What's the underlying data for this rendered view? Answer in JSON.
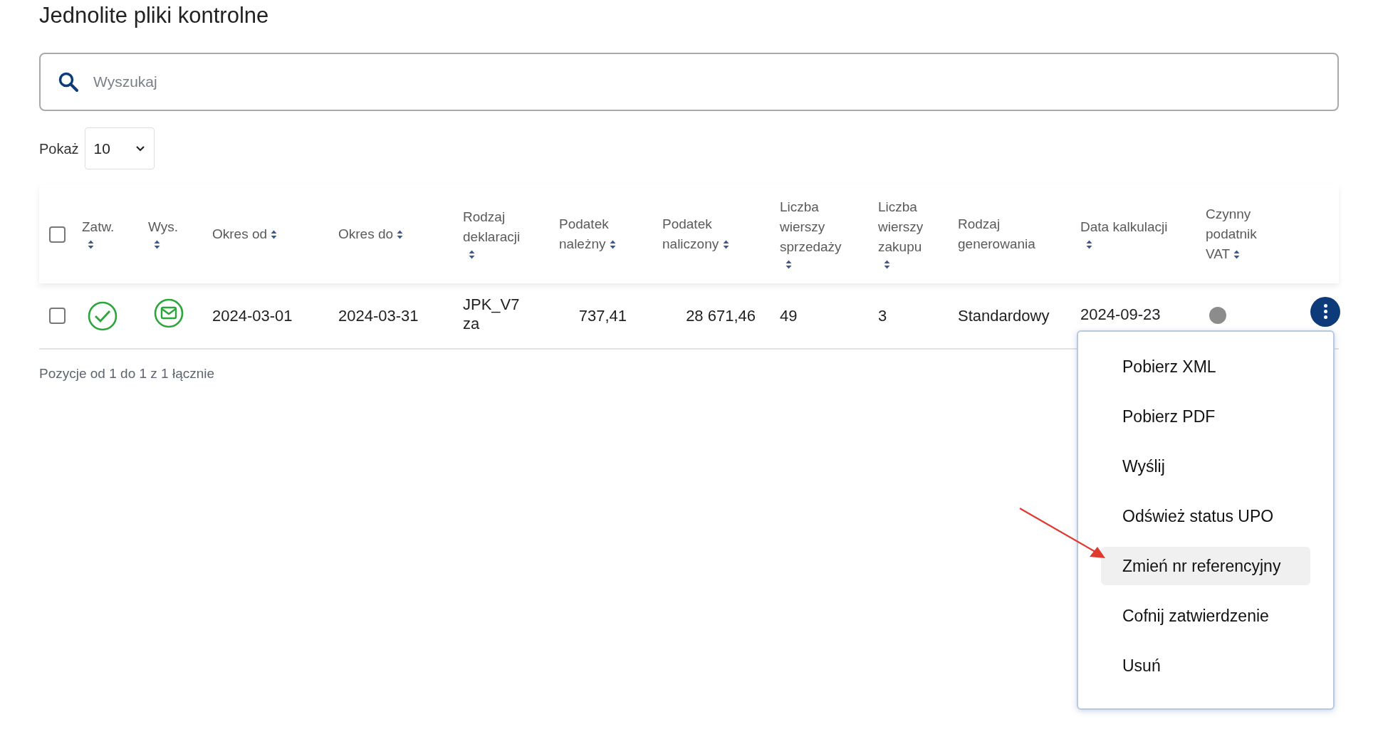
{
  "title": "Jednolite pliki kontrolne",
  "search": {
    "placeholder": "Wyszukaj"
  },
  "page_size": {
    "label": "Pokaż",
    "value": "10"
  },
  "table": {
    "select_all": {
      "checked": false
    },
    "columns": [
      {
        "label": "Zatw.",
        "sortable": true,
        "sort_below": true
      },
      {
        "label": "Wys.",
        "sortable": true,
        "sort_below": true
      },
      {
        "label": "Okres od",
        "sortable": true,
        "sort_below": false
      },
      {
        "label": "Okres do",
        "sortable": true,
        "sort_below": false
      },
      {
        "label": "Rodzaj\ndeklaracji",
        "sortable": true,
        "sort_below": true
      },
      {
        "label": "Podatek\nnależny",
        "sortable": true,
        "sort_below": false
      },
      {
        "label": "Podatek\nnaliczony",
        "sortable": true,
        "sort_below": false
      },
      {
        "label": "Liczba\nwierszy\nsprzedaży",
        "sortable": true,
        "sort_below": true
      },
      {
        "label": "Liczba\nwierszy\nzakupu",
        "sortable": true,
        "sort_below": true
      },
      {
        "label": "Rodzaj\ngenerowania",
        "sortable": false
      },
      {
        "label": "Data kalkulacji",
        "sortable": true,
        "sort_below": true
      },
      {
        "label": "Czynny\npodatnik\nVAT",
        "sortable": true,
        "sort_below": false
      }
    ],
    "rows": [
      {
        "checked": false,
        "approved": true,
        "sent": true,
        "period_from": "2024-03-01",
        "period_to": "2024-03-31",
        "declaration": "JPK_V7\nza",
        "tax_due": "737,41",
        "tax_input": "28 671,46",
        "sales_rows": "49",
        "purchase_rows": "3",
        "generation": "Standardowy",
        "calc_date": "2024-09-23",
        "vat_status": {
          "color": "#8c8c8c"
        }
      }
    ]
  },
  "footer": "Pozycje od 1 do 1 z 1 łącznie",
  "context_menu": {
    "items": [
      {
        "label": "Pobierz XML",
        "selected": false
      },
      {
        "label": "Pobierz PDF",
        "selected": false
      },
      {
        "label": "Wyślij",
        "selected": false
      },
      {
        "label": "Odśwież status UPO",
        "selected": false
      },
      {
        "label": "Zmień nr referencyjny",
        "selected": true
      },
      {
        "label": "Cofnij zatwierdzenie",
        "selected": false
      },
      {
        "label": "Usuń",
        "selected": false
      }
    ]
  }
}
